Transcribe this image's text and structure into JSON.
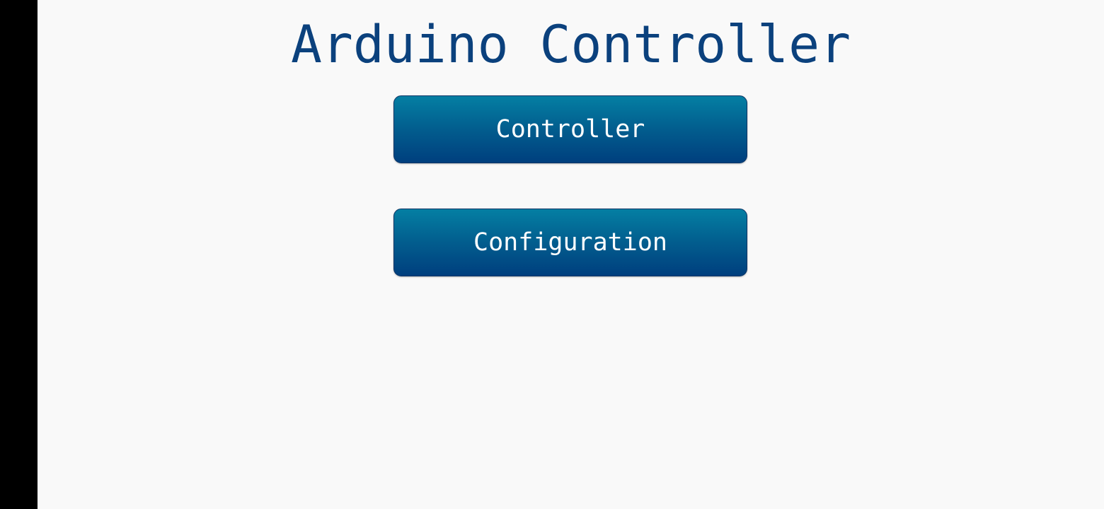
{
  "app": {
    "title": "Arduino Controller"
  },
  "menu": {
    "controller_label": "Controller",
    "configuration_label": "Configuration"
  },
  "colors": {
    "title": "#0b417d",
    "background": "#f9f9f9",
    "button_top": "#047fa3",
    "button_bottom": "#003f7e",
    "button_text": "#ffffff",
    "side_bar": "#000000"
  }
}
